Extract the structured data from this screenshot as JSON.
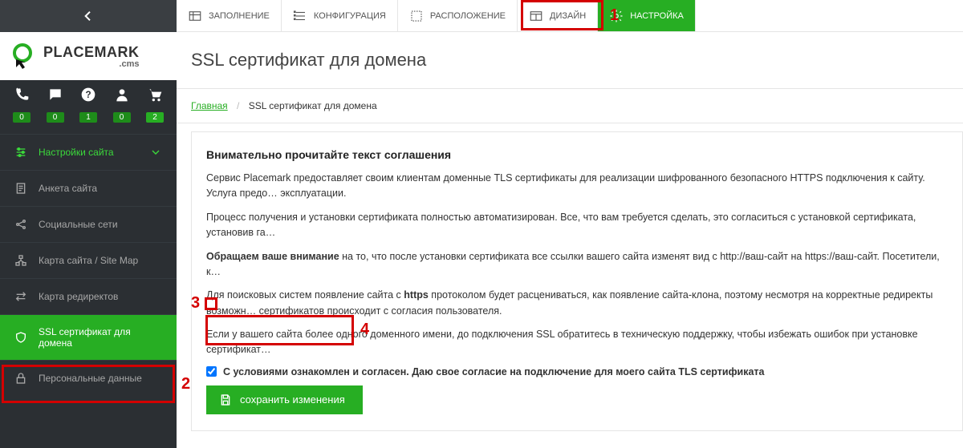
{
  "topnav": {
    "items": [
      {
        "label": "ЗАПОЛНЕНИЕ",
        "active": false
      },
      {
        "label": "КОНФИГУРАЦИЯ",
        "active": false
      },
      {
        "label": "РАСПОЛОЖЕНИЕ",
        "active": false
      },
      {
        "label": "ДИЗАЙН",
        "active": false
      },
      {
        "label": "НАСТРОЙКА",
        "active": true
      }
    ]
  },
  "logo": {
    "brand_main": "PLACEMARK",
    "brand_sub": ".cms"
  },
  "quick": {
    "items": [
      {
        "icon": "phone-icon",
        "badge": "0",
        "cls": "badge-green-dark"
      },
      {
        "icon": "chat-icon",
        "badge": "0",
        "cls": "badge-green-dark"
      },
      {
        "icon": "help-icon",
        "badge": "1",
        "cls": "badge-green-dark"
      },
      {
        "icon": "user-icon",
        "badge": "0",
        "cls": "badge-green-dark"
      },
      {
        "icon": "cart-icon",
        "badge": "2",
        "cls": "badge-green"
      }
    ]
  },
  "sidebar": {
    "items": [
      {
        "label": "Настройки сайта",
        "icon": "sliders-icon",
        "variant": "settings"
      },
      {
        "label": "Анкета сайта",
        "icon": "form-icon"
      },
      {
        "label": "Социальные сети",
        "icon": "share-icon"
      },
      {
        "label": "Карта сайта / Site Map",
        "icon": "sitemap-icon"
      },
      {
        "label": "Карта редиректов",
        "icon": "redirect-icon"
      },
      {
        "label": "SSL сертификат для домена",
        "icon": "shield-icon",
        "variant": "active"
      },
      {
        "label": "Персональные данные",
        "icon": "lock-icon"
      }
    ]
  },
  "page": {
    "title": "SSL сертификат для домена",
    "breadcrumb_home": "Главная",
    "breadcrumb_current": "SSL сертификат для домена",
    "agreement_heading": "Внимательно прочитайте текст соглашения",
    "p1": "Сервис Placemark предоставляет своим клиентам доменные TLS сертификаты для реализации шифрованного безопасного HTTPS подключения к сайту. Услуга предо… эксплуатации.",
    "p2": "Процесс получения и установки сертификата полностью автоматизирован. Все, что вам требуется сделать, это согласиться с установкой сертификата, установив га…",
    "p3_strong": "Обращаем ваше внимание",
    "p3_rest": " на то, что после установки сертификата все ссылки вашего сайта изменят вид с http://ваш-сайт на https://ваш-сайт. Посетители, к…",
    "p4_a": "Для поисковых систем появление сайта с ",
    "p4_b_strong": "https",
    "p4_c": " протоколом будет расцениваться, как появление сайта-клона, поэтому несмотря на корректные редиректы возможн… сертификатов происходит с согласия пользователя.",
    "p5": "Если у вашего сайта более одного доменного имени, до подключения SSL обратитесь в техническую поддержку, чтобы избежать ошибок при установке сертификат…",
    "consent_label": "С условиями ознакомлен и согласен. Даю свое согласие на подключение для моего сайта TLS сертификата",
    "save_button": "сохранить изменения"
  },
  "annotations": {
    "a1": "1",
    "a2": "2",
    "a3": "3",
    "a4": "4"
  }
}
